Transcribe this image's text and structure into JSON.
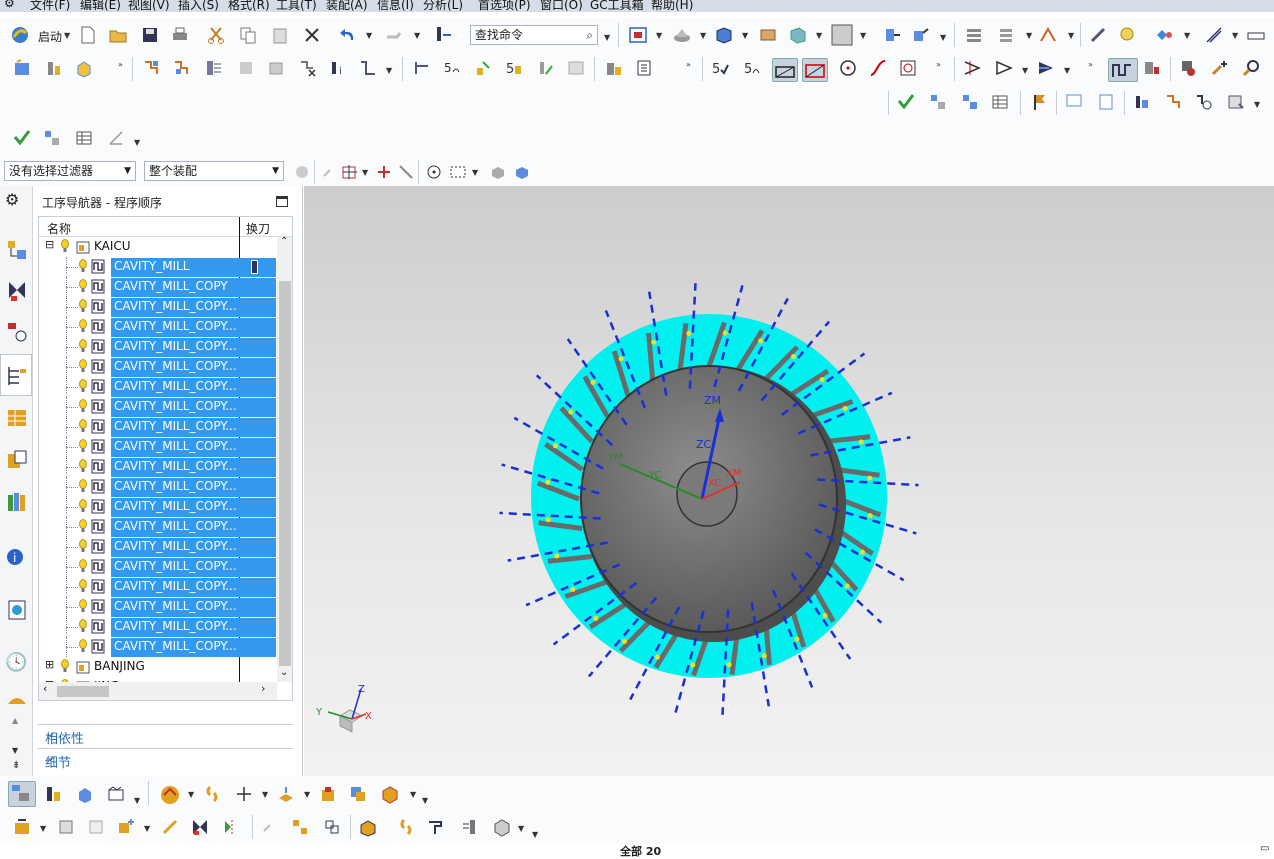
{
  "menu": {
    "items": [
      "文件(F)",
      "编辑(E)",
      "视图(V)",
      "插入(S)",
      "格式(R)",
      "工具(T)",
      "装配(A)",
      "信息(I)",
      "分析(L)",
      "首选项(P)",
      "窗口(O)",
      "GC工具箱",
      "帮助(H)"
    ]
  },
  "toolbar": {
    "start_label": "启动",
    "search_placeholder": "查找命令"
  },
  "selection_bar": {
    "filter_value": "没有选择过滤器",
    "scope_value": "整个装配"
  },
  "navigator": {
    "title": "工序导航器 - 程序顺序",
    "col_name": "名称",
    "col_tool": "换刀",
    "root_group": "KAICU",
    "operations": [
      "CAVITY_MILL",
      "CAVITY_MILL_COPY",
      "CAVITY_MILL_COPY...",
      "CAVITY_MILL_COPY...",
      "CAVITY_MILL_COPY...",
      "CAVITY_MILL_COPY...",
      "CAVITY_MILL_COPY...",
      "CAVITY_MILL_COPY...",
      "CAVITY_MILL_COPY...",
      "CAVITY_MILL_COPY...",
      "CAVITY_MILL_COPY...",
      "CAVITY_MILL_COPY...",
      "CAVITY_MILL_COPY...",
      "CAVITY_MILL_COPY...",
      "CAVITY_MILL_COPY...",
      "CAVITY_MILL_COPY...",
      "CAVITY_MILL_COPY...",
      "CAVITY_MILL_COPY...",
      "CAVITY_MILL_COPY...",
      "CAVITY_MILL_COPY..."
    ],
    "other_groups": [
      "BANJING",
      "JING"
    ],
    "sections": [
      "相依性",
      "细节"
    ]
  },
  "viewport": {
    "axis_labels": {
      "zm": "ZM",
      "zc": "ZC",
      "ym": "YM",
      "yc": "YC",
      "xm": "XM",
      "xc": "XC"
    },
    "triad": {
      "z": "Z",
      "y": "Y",
      "x": "X"
    }
  },
  "status": {
    "text": "全部 20"
  },
  "colors": {
    "selection": "#3399ee",
    "cyan_region": "#00f0f0",
    "toolpath": "#1a2fd6"
  }
}
